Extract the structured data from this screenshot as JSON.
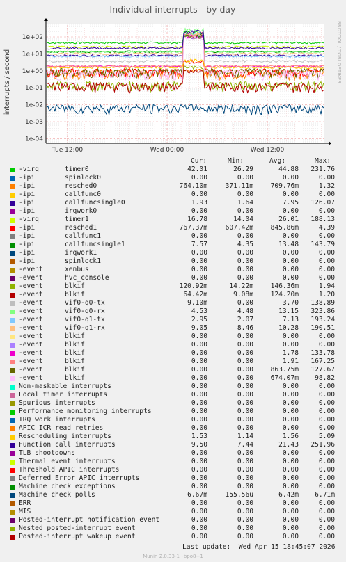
{
  "chart_data": {
    "type": "line",
    "title": "Individual interrupts - by day",
    "ylabel": "interrupts / second",
    "yscale": "log",
    "ylim": [
      5e-05,
      500
    ],
    "yticks": [
      "1e+02",
      "1e+01",
      "1e+00",
      "1e-01",
      "1e-02",
      "1e-03",
      "1e-04"
    ],
    "ytick_values": [
      100,
      10,
      1,
      0.1,
      0.01,
      0.001,
      0.0001
    ],
    "xticks": [
      "Tue 12:00",
      "Wed 00:00",
      "Wed 12:00"
    ],
    "grid": true,
    "side_label": "RRDTOOL / TOBI OETIKER",
    "series": [
      {
        "name": "-virq timer0",
        "color": "#00cc00",
        "cur": "42.01",
        "min": "26.29",
        "avg": "44.88",
        "max": "231.76"
      },
      {
        "name": "-ipi spinlock0",
        "color": "#0066b3",
        "cur": "0.00",
        "min": "0.00",
        "avg": "0.00",
        "max": "0.00"
      },
      {
        "name": "-ipi resched0",
        "color": "#ff8000",
        "cur": "764.10m",
        "min": "371.11m",
        "avg": "709.76m",
        "max": "1.32"
      },
      {
        "name": "-ipi callfunc0",
        "color": "#ffcc00",
        "cur": "0.00",
        "min": "0.00",
        "avg": "0.00",
        "max": "0.00"
      },
      {
        "name": "-ipi callfuncsingle0",
        "color": "#330099",
        "cur": "1.93",
        "min": "1.64",
        "avg": "7.95",
        "max": "126.07"
      },
      {
        "name": "-ipi irqwork0",
        "color": "#990099",
        "cur": "0.00",
        "min": "0.00",
        "avg": "0.00",
        "max": "0.00"
      },
      {
        "name": "-virq timer1",
        "color": "#ccff00",
        "cur": "16.78",
        "min": "14.04",
        "avg": "26.01",
        "max": "188.13"
      },
      {
        "name": "-ipi resched1",
        "color": "#ff0000",
        "cur": "767.37m",
        "min": "607.42m",
        "avg": "845.86m",
        "max": "4.39"
      },
      {
        "name": "-ipi callfunc1",
        "color": "#808080",
        "cur": "0.00",
        "min": "0.00",
        "avg": "0.00",
        "max": "0.00"
      },
      {
        "name": "-ipi callfuncsingle1",
        "color": "#008f00",
        "cur": "7.57",
        "min": "4.35",
        "avg": "13.48",
        "max": "143.79"
      },
      {
        "name": "-ipi irqwork1",
        "color": "#00487d",
        "cur": "0.00",
        "min": "0.00",
        "avg": "0.00",
        "max": "0.00"
      },
      {
        "name": "-ipi spinlock1",
        "color": "#b35a00",
        "cur": "0.00",
        "min": "0.00",
        "avg": "0.00",
        "max": "0.00"
      },
      {
        "name": "-event xenbus",
        "color": "#b38f00",
        "cur": "0.00",
        "min": "0.00",
        "avg": "0.00",
        "max": "0.00"
      },
      {
        "name": "-event hvc_console",
        "color": "#6b006b",
        "cur": "0.00",
        "min": "0.00",
        "avg": "0.00",
        "max": "0.00"
      },
      {
        "name": "-event blkif",
        "color": "#8fb300",
        "cur": "120.92m",
        "min": "14.22m",
        "avg": "146.36m",
        "max": "1.94"
      },
      {
        "name": "-event blkif",
        "color": "#b30000",
        "cur": "64.42m",
        "min": "9.08m",
        "avg": "124.20m",
        "max": "1.20"
      },
      {
        "name": "-event vif0-q0-tx",
        "color": "#bebebe",
        "cur": "9.10m",
        "min": "0.00",
        "avg": "3.70",
        "max": "138.89"
      },
      {
        "name": "-event vif0-q0-rx",
        "color": "#80ff80",
        "cur": "4.53",
        "min": "4.48",
        "avg": "13.15",
        "max": "323.86"
      },
      {
        "name": "-event vif0-q1-tx",
        "color": "#80c9ff",
        "cur": "2.95",
        "min": "2.07",
        "avg": "7.13",
        "max": "193.24"
      },
      {
        "name": "-event vif0-q1-rx",
        "color": "#ffc080",
        "cur": "9.05",
        "min": "8.46",
        "avg": "10.28",
        "max": "190.51"
      },
      {
        "name": "-event blkif",
        "color": "#ffe680",
        "cur": "0.00",
        "min": "0.00",
        "avg": "0.00",
        "max": "0.00"
      },
      {
        "name": "-event blkif",
        "color": "#aa80ff",
        "cur": "0.00",
        "min": "0.00",
        "avg": "0.00",
        "max": "0.00"
      },
      {
        "name": "-event blkif",
        "color": "#ee00cc",
        "cur": "0.00",
        "min": "0.00",
        "avg": "1.78",
        "max": "133.78"
      },
      {
        "name": "-event blkif",
        "color": "#ff8080",
        "cur": "0.00",
        "min": "0.00",
        "avg": "1.91",
        "max": "167.25"
      },
      {
        "name": "-event blkif",
        "color": "#666600",
        "cur": "0.00",
        "min": "0.00",
        "avg": "863.75m",
        "max": "127.67"
      },
      {
        "name": "-event blkif",
        "color": "#ffbfff",
        "cur": "0.00",
        "min": "0.00",
        "avg": "674.07m",
        "max": "98.82"
      },
      {
        "name": "Non-maskable interrupts",
        "color": "#00ffcc",
        "cur": "0.00",
        "min": "0.00",
        "avg": "0.00",
        "max": "0.00"
      },
      {
        "name": "Local timer interrupts",
        "color": "#cc6699",
        "cur": "0.00",
        "min": "0.00",
        "avg": "0.00",
        "max": "0.00"
      },
      {
        "name": "Spurious interrupts",
        "color": "#999900",
        "cur": "0.00",
        "min": "0.00",
        "avg": "0.00",
        "max": "0.00"
      },
      {
        "name": "Performance monitoring interrupts",
        "color": "#00cc00",
        "cur": "0.00",
        "min": "0.00",
        "avg": "0.00",
        "max": "0.00"
      },
      {
        "name": "IRQ work interrupts",
        "color": "#0066b3",
        "cur": "0.00",
        "min": "0.00",
        "avg": "0.00",
        "max": "0.00"
      },
      {
        "name": "APIC ICR read retries",
        "color": "#ff8000",
        "cur": "0.00",
        "min": "0.00",
        "avg": "0.00",
        "max": "0.00"
      },
      {
        "name": "Rescheduling interrupts",
        "color": "#ffcc00",
        "cur": "1.53",
        "min": "1.14",
        "avg": "1.56",
        "max": "5.09"
      },
      {
        "name": "Function call interrupts",
        "color": "#330099",
        "cur": "9.50",
        "min": "7.44",
        "avg": "21.43",
        "max": "251.96"
      },
      {
        "name": "TLB shootdowns",
        "color": "#990099",
        "cur": "0.00",
        "min": "0.00",
        "avg": "0.00",
        "max": "0.00"
      },
      {
        "name": "Thermal event interrupts",
        "color": "#ccff00",
        "cur": "0.00",
        "min": "0.00",
        "avg": "0.00",
        "max": "0.00"
      },
      {
        "name": "Threshold APIC interrupts",
        "color": "#ff0000",
        "cur": "0.00",
        "min": "0.00",
        "avg": "0.00",
        "max": "0.00"
      },
      {
        "name": "Deferred Error APIC interrupts",
        "color": "#808080",
        "cur": "0.00",
        "min": "0.00",
        "avg": "0.00",
        "max": "0.00"
      },
      {
        "name": "Machine check exceptions",
        "color": "#008f00",
        "cur": "0.00",
        "min": "0.00",
        "avg": "0.00",
        "max": "0.00"
      },
      {
        "name": "Machine check polls",
        "color": "#00487d",
        "cur": "6.67m",
        "min": "155.56u",
        "avg": "6.42m",
        "max": "6.71m"
      },
      {
        "name": "ERR",
        "color": "#b35a00",
        "cur": "0.00",
        "min": "0.00",
        "avg": "0.00",
        "max": "0.00"
      },
      {
        "name": "MIS",
        "color": "#b38f00",
        "cur": "0.00",
        "min": "0.00",
        "avg": "0.00",
        "max": "0.00"
      },
      {
        "name": "Posted-interrupt notification event",
        "color": "#6b006b",
        "cur": "0.00",
        "min": "0.00",
        "avg": "0.00",
        "max": "0.00"
      },
      {
        "name": "Nested posted-interrupt event",
        "color": "#8fb300",
        "cur": "0.00",
        "min": "0.00",
        "avg": "0.00",
        "max": "0.00"
      },
      {
        "name": "Posted-interrupt wakeup event",
        "color": "#b30000",
        "cur": "0.00",
        "min": "0.00",
        "avg": "0.00",
        "max": "0.00"
      }
    ]
  },
  "legend_header": {
    "cur": "Cur:",
    "min": "Min:",
    "avg": "Avg:",
    "max": "Max:"
  },
  "last_update": "Last update:  Wed Apr 15 18:45:07 2026",
  "footer": "Munin 2.0.33-1~bpo8+1"
}
